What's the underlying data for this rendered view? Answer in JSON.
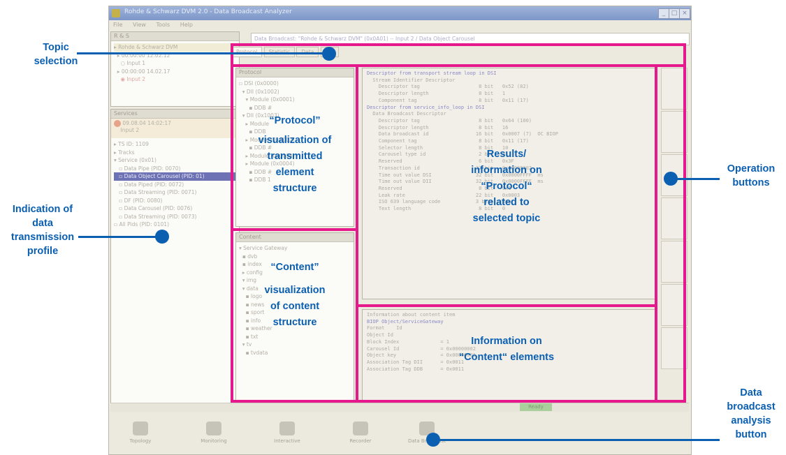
{
  "app": {
    "title": "Rohde & Schwarz DVM 2.0 - Data Broadcast Analyzer",
    "menu": [
      "File",
      "View",
      "Tools",
      "Help"
    ],
    "address": "Data Broadcast: \"Rohde & Schwarz DVM\" (0x0A01) -- Input 2 / Data Object Carousel",
    "tabs": [
      "Protocol",
      "Statistic",
      "Data",
      "Util"
    ],
    "left_top_header": "R & S",
    "left_top_tree": [
      "Rohde & Schwarz DVM",
      "00:00:00 12.02.12",
      "Input 1",
      "00:00:00 14.02.17",
      "Input 2"
    ],
    "left_bottom_header": "Services",
    "left_bottom_head_item": [
      "09.08.04 14:02:17",
      "Input 2"
    ],
    "left_bottom_tree": [
      "TS ID: 1109",
      "Tracks",
      "Service (0x01)",
      "Data Pipe (PID: 0070)",
      "Data Object Carousel (PID: 01)",
      "Data Piped (PID: 0072)",
      "Data Streaming (PID: 0071)",
      "DF (PID: 0080)",
      "Data Carousel (PID: 0076)",
      "Data Streaming (PID: 0073)",
      "All Pids (PID: 0101)"
    ],
    "protocol_header": "Protocol",
    "protocol_tree": [
      "DSI (0x0000)",
      "DII (0x1002)",
      "Module (0x0001)",
      "DDB #",
      "DII (0x1003)",
      "Module",
      "DDB",
      "Module (0x0002)",
      "DDB #",
      "Module (0x0003)",
      "Module (0x0004)",
      "DDB #",
      "DDB 1"
    ],
    "content_header": "Content",
    "content_tree": [
      "Service Gateway",
      "dvb",
      "index",
      "config",
      "img",
      "data",
      "logo",
      "news",
      "sport",
      "info",
      "weather",
      "txt",
      "tv",
      "tvdata"
    ],
    "results_lines": [
      "Descriptor from transport stream loop in DSI",
      "  Stream Identifier Descriptor",
      "    Descriptor tag                    8 bit   0x52 (82)",
      "    Descriptor length                 8 bit   1",
      "    Component tag                     8 bit   0x11 (17)",
      "Descriptor from service_info_loop in DSI",
      "  Data Broadcast Descriptor",
      "    Descriptor tag                    8 bit   0x64 (100)",
      "    Descriptor length                 8 bit   16",
      "    Data broadcast id                16 bit   0x0007 (7)  OC BIOP",
      "    Component tag                     8 bit   0x11 (17)",
      "    Selector length                   8 bit   10",
      "    Carousel type id                  2 bit   2",
      "    Reserved                          6 bit   0x3F",
      "    Transaction id                   32 bit   0x80000002",
      "    Time out value DSI               32 bit   0x0000FFFF  ms",
      "    Time out value DII               32 bit   0x0000FFFF  ms",
      "    Reserved                          8 bit   0x1",
      "    Leak rate                        22 bit   0x0003",
      "    ISO 639 language code            3 byte   deu",
      "    Text length                       8 bit   0"
    ],
    "content_info_lines": [
      "Information about content item",
      "BIOP Object/ServiceGateway",
      "Format    Id",
      "Object Id",
      "Block Index              = 1",
      "Carousel Id              = 0x00000002",
      "Object key               = 0x00000001",
      "Association Tag DII      = 0x0011",
      "Association Tag DDB      = 0x0011"
    ],
    "status_text": "Ready",
    "toolbar_buttons": [
      "Topology",
      "Monitoring",
      "Interactive",
      "Recorder",
      "Data Broadcast"
    ]
  },
  "annotations": {
    "topic_selection": [
      "Topic",
      "selection"
    ],
    "data_transmission": [
      "Indication of",
      "data",
      "transmission",
      "profile"
    ],
    "operation_buttons": [
      "Operation",
      "buttons"
    ],
    "data_broadcast_button": [
      "Data",
      "broadcast",
      "analysis",
      "button"
    ],
    "protocol_vis": [
      "“Protocol”",
      "visualization of",
      "transmitted",
      "element",
      "structure"
    ],
    "content_vis": [
      "“Content”",
      "visualization",
      "of content",
      "structure"
    ],
    "results": [
      "Results/",
      "information on",
      "“Protocol“",
      "related to",
      "selected topic"
    ],
    "content_info": [
      "Information on",
      "“Content“ elements"
    ]
  },
  "colors": {
    "highlight_frame": "#e5198b",
    "annotation_blue": "#0b5fb0",
    "tree_selection": "#6d72b4"
  }
}
